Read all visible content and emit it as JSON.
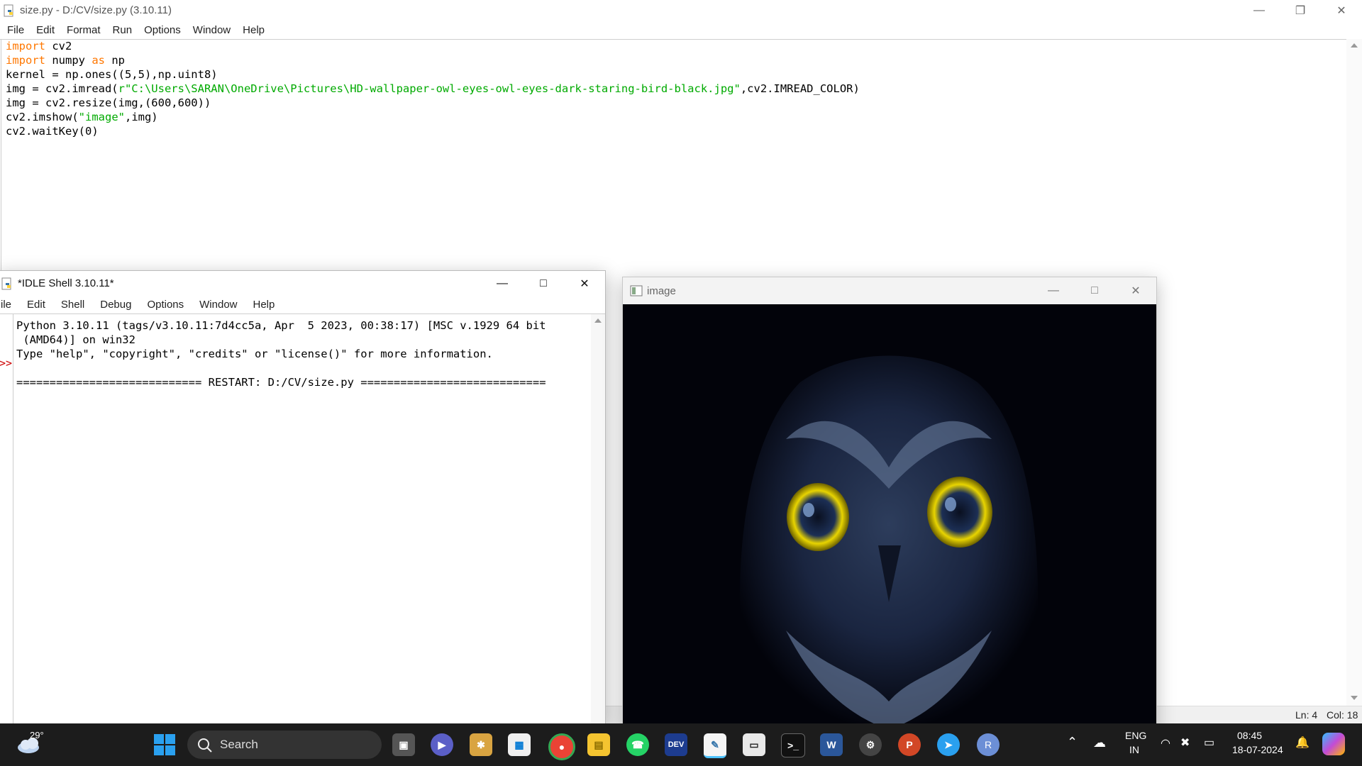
{
  "editor": {
    "title": "size.py - D:/CV/size.py (3.10.11)",
    "menu": [
      "File",
      "Edit",
      "Format",
      "Run",
      "Options",
      "Window",
      "Help"
    ],
    "code": [
      {
        "kw": "import",
        "rest": " cv2"
      },
      {
        "kw": "import",
        "rest": " numpy ",
        "kw2": "as",
        "rest2": " np"
      },
      {
        "plain": "kernel = np.ones((5,5),np.uint8)"
      },
      {
        "pre": "img = cv2.imread(",
        "str": "r\"C:\\Users\\SARAN\\OneDrive\\Pictures\\HD-wallpaper-owl-eyes-owl-eyes-dark-staring-bird-black.jpg\"",
        "post": ",cv2.IMREAD_COLOR)"
      },
      {
        "plain": "img = cv2.resize(img,(600,600))"
      },
      {
        "pre": "cv2.imshow(",
        "str": "\"image\"",
        "post": ",img)"
      },
      {
        "plain": "cv2.waitKey(0)"
      }
    ],
    "status": {
      "line": "Ln: 4",
      "col": "Col: 18"
    }
  },
  "shell": {
    "title": "*IDLE Shell 3.10.11*",
    "menu": [
      "ile",
      "Edit",
      "Shell",
      "Debug",
      "Options",
      "Window",
      "Help"
    ],
    "lines": [
      "Python 3.10.11 (tags/v3.10.11:7d4cc5a, Apr  5 2023, 00:38:17) [MSC v.1929 64 bit",
      " (AMD64)] on win32",
      "Type \"help\", \"copyright\", \"credits\" or \"license()\" for more information.",
      "",
      "============================ RESTART: D:/CV/size.py ============================"
    ],
    "prompt": ">>"
  },
  "image_window": {
    "title": "image",
    "subject": "owl with glowing yellow eyes on black background"
  },
  "taskbar": {
    "weather": "29°",
    "search_label": "Search",
    "apps": [
      "task-view",
      "teams-meet",
      "photos",
      "store",
      "chrome",
      "file-explorer",
      "whatsapp",
      "dev-home",
      "python-idle",
      "remote-desktop",
      "terminal",
      "word",
      "settings",
      "powerpoint",
      "telegram",
      "r-app"
    ],
    "lang_top": "ENG",
    "lang_bottom": "IN",
    "time": "08:45",
    "date": "18-07-2024"
  },
  "colors": {
    "keyword": "#ff7700",
    "string": "#00aa00",
    "prompt": "#cc0000",
    "taskbar": "#1c1c1c",
    "owl_eye": "#e8d400"
  }
}
